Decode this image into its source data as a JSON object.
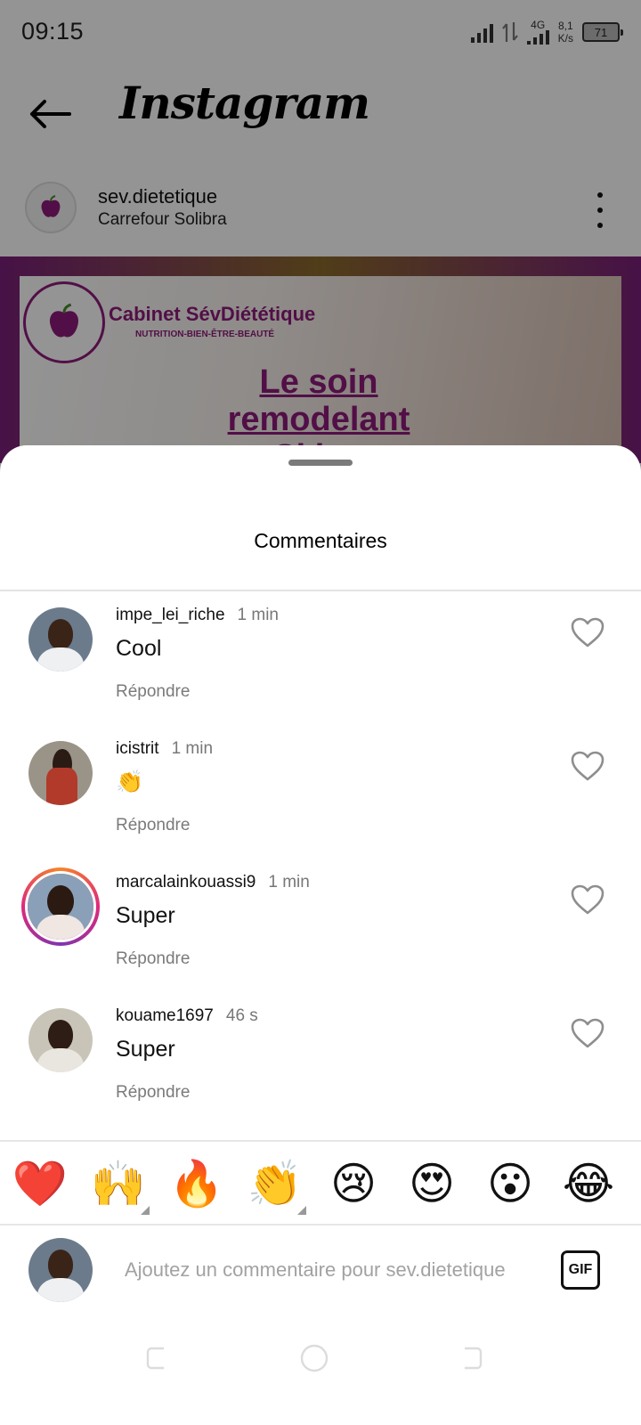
{
  "status_bar": {
    "time": "09:15",
    "network": "4G",
    "speed_value": "8,1",
    "speed_unit": "K/s",
    "battery": "71"
  },
  "header": {
    "brand": "Instagram"
  },
  "post": {
    "username": "sev.dietetique",
    "location": "Carrefour Solibra",
    "image": {
      "brand": "Cabinet SévDiététique",
      "tagline": "NUTRITION-BIEN-ÊTRE-BEAUTÉ",
      "title_line1": "Le soin remodelant",
      "title_line2": "Skiny"
    }
  },
  "sheet": {
    "title": "Commentaires",
    "comments": [
      {
        "user": "impe_lei_riche",
        "time": "1 min",
        "text": "Cool",
        "reply": "Répondre",
        "avatar": "avatar-photo",
        "story_ring": false
      },
      {
        "user": "icistrit",
        "time": "1 min",
        "text": "👏",
        "reply": "Répondre",
        "avatar": "avatar-photo",
        "story_ring": false
      },
      {
        "user": "marcalainkouassi9",
        "time": "1 min",
        "text": "Super",
        "reply": "Répondre",
        "avatar": "avatar-photo",
        "story_ring": true
      },
      {
        "user": "kouame1697",
        "time": "46 s",
        "text": "Super",
        "reply": "Répondre",
        "avatar": "avatar-photo",
        "story_ring": false
      }
    ],
    "reactions": [
      "❤️",
      "🙌",
      "🔥",
      "👏",
      "😢",
      "😍",
      "😮",
      "😂"
    ],
    "composer": {
      "placeholder": "Ajoutez un commentaire pour sev.dietetique",
      "gif_label": "GIF"
    }
  },
  "colors": {
    "brand_purple": "#8e1b7a",
    "story_ring_start": "#f58529",
    "story_ring_mid": "#dd2a7b",
    "like_stroke": "#8e8e8e"
  },
  "icons": [
    "back-arrow-icon",
    "more-vertical-icon",
    "heart-outline-icon",
    "gif-icon",
    "signal-icon",
    "battery-icon"
  ]
}
